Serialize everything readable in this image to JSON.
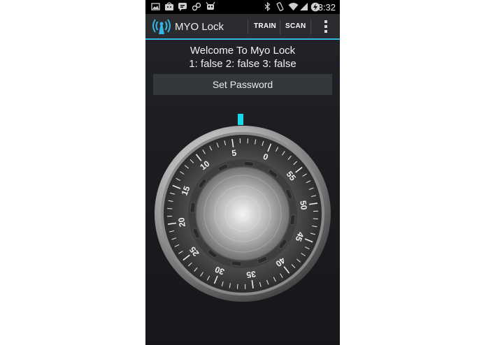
{
  "status_bar": {
    "time": "3:32",
    "left_icons": [
      "image-icon",
      "android-market-icon",
      "chat-icon",
      "link-icon",
      "android-icon"
    ],
    "right_icons": [
      "bluetooth-icon",
      "vibrate-icon",
      "wifi-icon",
      "signal-icon",
      "battery-charging-icon"
    ]
  },
  "action_bar": {
    "title": "MYO Lock",
    "icon": "signal-logo-icon",
    "actions": [
      {
        "label": "TRAIN"
      },
      {
        "label": "SCAN"
      }
    ],
    "overflow_icon": "overflow-menu-icon"
  },
  "content": {
    "welcome": "Welcome To Myo Lock",
    "status_line": "1: false 2: false 3: false",
    "set_password_label": "Set Password"
  },
  "dial": {
    "numbers": [
      "0",
      "5",
      "10",
      "15",
      "20",
      "25",
      "30",
      "35",
      "40",
      "45",
      "50",
      "55"
    ],
    "pointer_color": "#19d8e8"
  },
  "colors": {
    "accent": "#33b5e5",
    "pointer": "#19d8e8",
    "background": "#1b1d21"
  }
}
